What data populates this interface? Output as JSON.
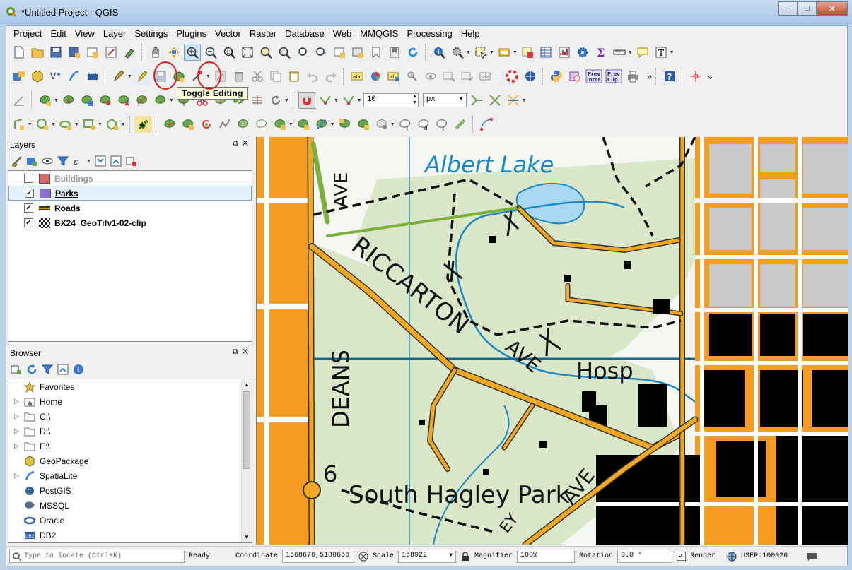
{
  "window": {
    "title": "*Untitled Project - QGIS"
  },
  "menu": [
    "Project",
    "Edit",
    "View",
    "Layer",
    "Settings",
    "Plugins",
    "Vector",
    "Raster",
    "Database",
    "Web",
    "MMQGIS",
    "Processing",
    "Help"
  ],
  "tooltip": "Toggle Editing",
  "toolbar": {
    "snap_tolerance": "10",
    "snap_unit": "px",
    "prev_inter": "Prev\nInter",
    "prev_clip": "Prev\nClip"
  },
  "layers_panel": {
    "title": "Layers",
    "layers": [
      {
        "name": "Buildings",
        "checked": false,
        "color": "#d46a6a",
        "dim": true
      },
      {
        "name": "Parks",
        "checked": true,
        "color": "#8a6fd6",
        "selected": true
      },
      {
        "name": "Roads",
        "checked": true,
        "color": "#c9950c"
      },
      {
        "name": "BX24_GeoTifv1-02-clip",
        "checked": true,
        "color": "#333333"
      }
    ]
  },
  "browser_panel": {
    "title": "Browser",
    "items": [
      {
        "label": "Favorites",
        "icon": "star-icon",
        "arrow": false
      },
      {
        "label": "Home",
        "icon": "home-folder-icon",
        "arrow": true
      },
      {
        "label": "C:\\",
        "icon": "folder-icon",
        "arrow": true
      },
      {
        "label": "D:\\",
        "icon": "folder-icon",
        "arrow": true
      },
      {
        "label": "E:\\",
        "icon": "folder-icon",
        "arrow": true
      },
      {
        "label": "GeoPackage",
        "icon": "geopackage-icon",
        "arrow": false
      },
      {
        "label": "SpatiaLite",
        "icon": "spatialite-icon",
        "arrow": true
      },
      {
        "label": "PostGIS",
        "icon": "postgis-icon",
        "arrow": false
      },
      {
        "label": "MSSQL",
        "icon": "mssql-icon",
        "arrow": false
      },
      {
        "label": "Oracle",
        "icon": "oracle-icon",
        "arrow": false
      },
      {
        "label": "DB2",
        "icon": "db2-icon",
        "arrow": false
      }
    ]
  },
  "map_labels": {
    "lake": "Albert Lake",
    "ave_top": "AVE",
    "riccarton": "RICCARTON",
    "ave_mid": "AVE",
    "hosp": "Hosp",
    "deans": "DEANS",
    "six": "6",
    "park": "South Hagley Park",
    "ave_bottom": "AVE",
    "ey": "EY"
  },
  "statusbar": {
    "locate_placeholder": "Type to locate (Ctrl+K)",
    "ready": "Ready",
    "coordinate_label": "Coordinate",
    "coordinate": "1568676,5180656",
    "scale_label": "Scale",
    "scale": "1:8922",
    "magnifier_label": "Magnifier",
    "magnifier": "100%",
    "rotation_label": "Rotation",
    "rotation": "0.0 °",
    "render_label": "Render",
    "crs": "USER:100026"
  }
}
